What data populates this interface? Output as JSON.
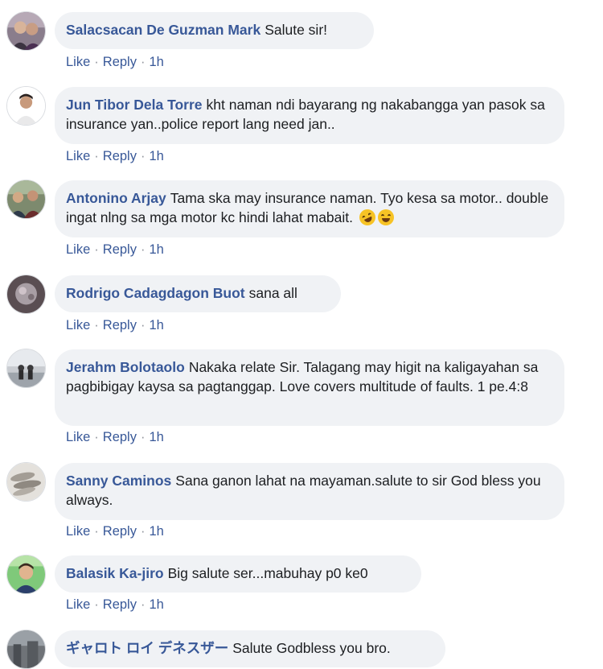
{
  "actions": {
    "like": "Like",
    "reply": "Reply",
    "separator": "·"
  },
  "comments": [
    {
      "author": "Salacsacan De Guzman Mark",
      "text": "Salute sir!",
      "time": "1h"
    },
    {
      "author": "Jun Tibor Dela Torre",
      "text": "kht naman ndi bayarang ng nakabangga yan pasok sa insurance yan..police report lang need jan..",
      "time": "1h"
    },
    {
      "author": "Antonino Arjay",
      "text": "Tama ska may insurance naman. Tyo kesa sa motor.. double ingat nlng sa mga motor kc hindi lahat mabait.",
      "emojis": [
        "rolling-on-floor-laughing-emoji",
        "laughing-emoji"
      ],
      "time": "1h"
    },
    {
      "author": "Rodrigo Cadagdagon Buot",
      "text": "sana all",
      "time": "1h"
    },
    {
      "author": "Jerahm Bolotaolo",
      "text": "Nakaka relate Sir. Talagang may higit na kaligayahan sa pagbibigay kaysa sa pagtanggap. Love covers multitude of faults. 1 pe.4:8",
      "time": "1h"
    },
    {
      "author": "Sanny Caminos",
      "text": "Sana ganon lahat na mayaman.salute to sir God bless you always.",
      "time": "1h"
    },
    {
      "author": "Balasik Ka-jiro",
      "text": "Big salute ser...mabuhay p0 ke0",
      "time": "1h"
    },
    {
      "author": "ギャロト ロイ デネスザー",
      "text": "Salute Godbless you bro.",
      "time": ""
    }
  ]
}
